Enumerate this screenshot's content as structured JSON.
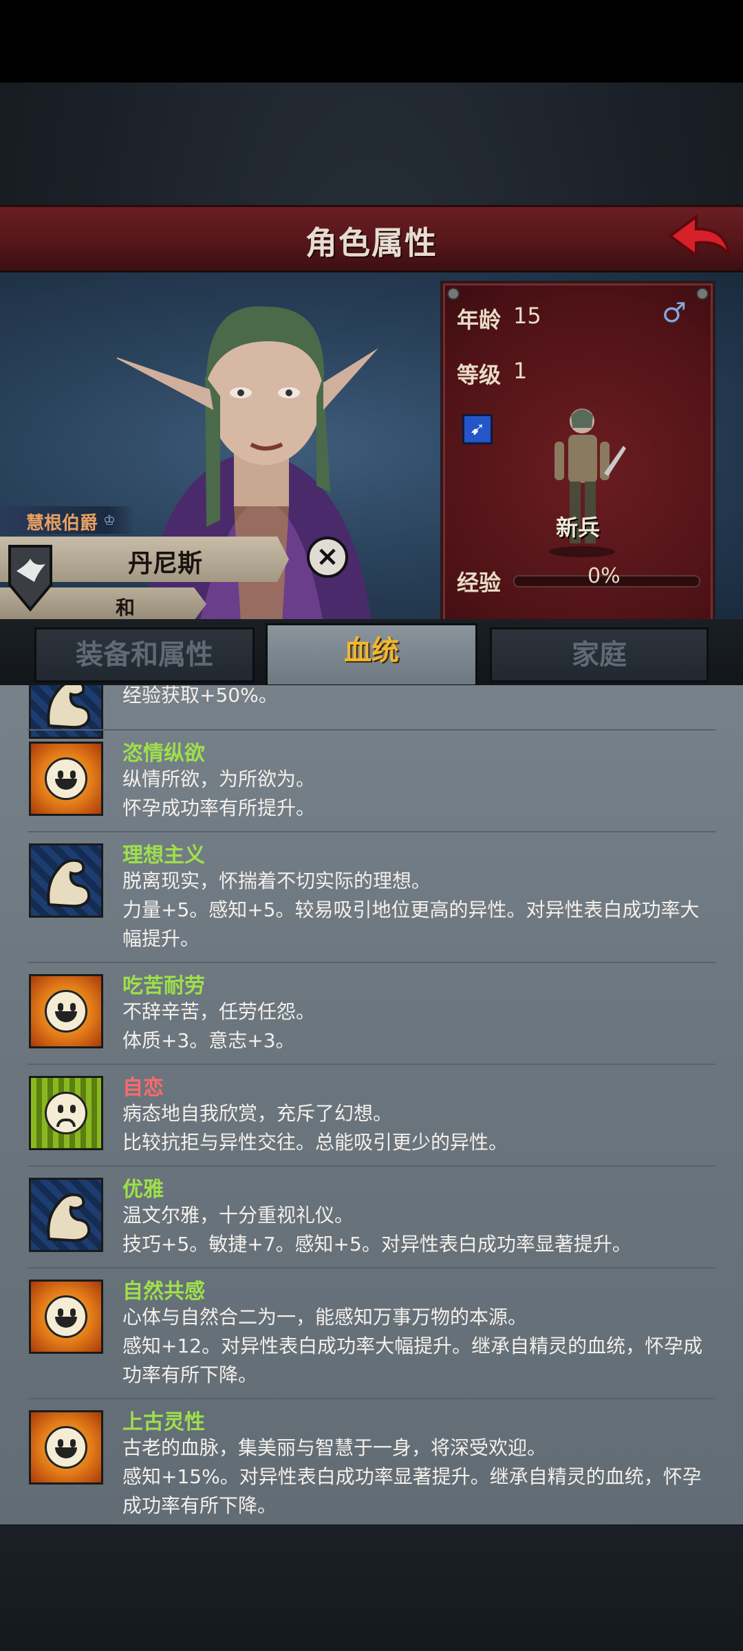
{
  "header": {
    "title": "角色属性"
  },
  "character": {
    "title": "慧根伯爵",
    "name": "丹尼斯",
    "subtitle": "和",
    "age_label": "年龄",
    "age": "15",
    "gender_icon": "male-icon",
    "level_label": "等级",
    "level": "1",
    "class": "新兵",
    "xp_label": "经验",
    "xp": "0%",
    "xp_fraction": 0
  },
  "tabs": [
    {
      "label": "装备和属性",
      "active": false
    },
    {
      "label": "血统",
      "active": true
    },
    {
      "label": "家庭",
      "active": false
    }
  ],
  "traits": [
    {
      "name": "",
      "icon": "arm",
      "desc": "经验获取+50%。",
      "kind": "good"
    },
    {
      "name": "恣情纵欲",
      "icon": "sun",
      "desc": "纵情所欲，为所欲为。\n怀孕成功率有所提升。",
      "kind": "good"
    },
    {
      "name": "理想主义",
      "icon": "arm",
      "desc": "脱离现实，怀揣着不切实际的理想。\n力量+5。感知+5。较易吸引地位更高的异性。对异性表白成功率大幅提升。",
      "kind": "good"
    },
    {
      "name": "吃苦耐劳",
      "icon": "sun",
      "desc": "不辞辛苦，任劳任怨。\n体质+3。意志+3。",
      "kind": "good"
    },
    {
      "name": "自恋",
      "icon": "sad",
      "desc": "病态地自我欣赏，充斥了幻想。\n比较抗拒与异性交往。总能吸引更少的异性。",
      "kind": "bad"
    },
    {
      "name": "优雅",
      "icon": "arm",
      "desc": "温文尔雅，十分重视礼仪。\n技巧+5。敏捷+7。感知+5。对异性表白成功率显著提升。",
      "kind": "good"
    },
    {
      "name": "自然共感",
      "icon": "sun",
      "desc": "心体与自然合二为一，能感知万事万物的本源。\n感知+12。对异性表白成功率大幅提升。继承自精灵的血统，怀孕成功率有所下降。",
      "kind": "good"
    },
    {
      "name": "上古灵性",
      "icon": "sun",
      "desc": "古老的血脉，集美丽与智慧于一身，将深受欢迎。\n感知+15%。对异性表白成功率显著提升。继承自精灵的血统，怀孕成功率有所下降。",
      "kind": "good"
    }
  ]
}
